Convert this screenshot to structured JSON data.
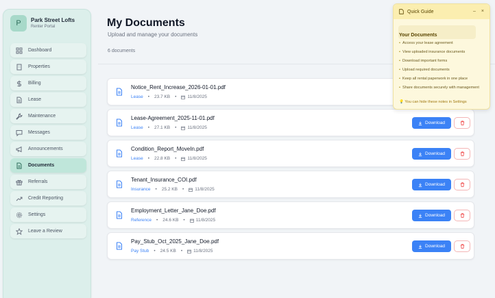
{
  "sidebar": {
    "brand_initial": "P",
    "brand_name": "Park Street Lofts",
    "brand_sub": "Renter Portal",
    "items": [
      {
        "label": "Dashboard",
        "icon": "grid-icon"
      },
      {
        "label": "Properties",
        "icon": "building-icon"
      },
      {
        "label": "Billing",
        "icon": "dollar-icon"
      },
      {
        "label": "Lease",
        "icon": "file-icon"
      },
      {
        "label": "Maintenance",
        "icon": "wrench-icon"
      },
      {
        "label": "Messages",
        "icon": "chat-icon"
      },
      {
        "label": "Announcements",
        "icon": "megaphone-icon"
      },
      {
        "label": "Documents",
        "icon": "document-icon",
        "active": true
      },
      {
        "label": "Referrals",
        "icon": "gift-icon"
      },
      {
        "label": "Credit Reporting",
        "icon": "trending-up-icon"
      },
      {
        "label": "Settings",
        "icon": "gear-icon"
      },
      {
        "label": "Leave a Review",
        "icon": "star-icon"
      }
    ]
  },
  "main": {
    "title": "My Documents",
    "subtitle": "Upload and manage your documents",
    "count": "6 documents",
    "download_label": "Download",
    "documents": [
      {
        "name": "Notice_Rent_Increase_2026-01-01.pdf",
        "category": "Lease",
        "size": "23.7 KB",
        "date": "11/8/2025"
      },
      {
        "name": "Lease-Agreement_2025-11-01.pdf",
        "category": "Lease",
        "size": "27.1 KB",
        "date": "11/8/2025"
      },
      {
        "name": "Condition_Report_MoveIn.pdf",
        "category": "Lease",
        "size": "22.8 KB",
        "date": "11/8/2025"
      },
      {
        "name": "Tenant_Insurance_COI.pdf",
        "category": "Insurance",
        "size": "25.2 KB",
        "date": "11/8/2025"
      },
      {
        "name": "Employment_Letter_Jane_Doe.pdf",
        "category": "Reference",
        "size": "24.6 KB",
        "date": "11/8/2025"
      },
      {
        "name": "Pay_Stub_Oct_2025_Jane_Doe.pdf",
        "category": "Pay Stub",
        "size": "24.5 KB",
        "date": "11/8/2025"
      }
    ]
  },
  "guide": {
    "title": "Quick Guide",
    "minimize": "–",
    "close": "×",
    "section": "Your Documents",
    "bullet": "•",
    "items": [
      "Access your lease agreement",
      "View uploaded insurance documents",
      "Download important forms",
      "Upload required documents",
      "Keep all rental paperwork in one place",
      "Share documents securely with management"
    ],
    "tip": "You can hide these notes in Settings"
  },
  "colors": {
    "accent": "#3b82f6",
    "sidebar_bg": "#dcefeb",
    "active_nav": "#bfe6da",
    "guide_bg": "#fdf8dd",
    "delete_border": "#f4b5b5"
  }
}
